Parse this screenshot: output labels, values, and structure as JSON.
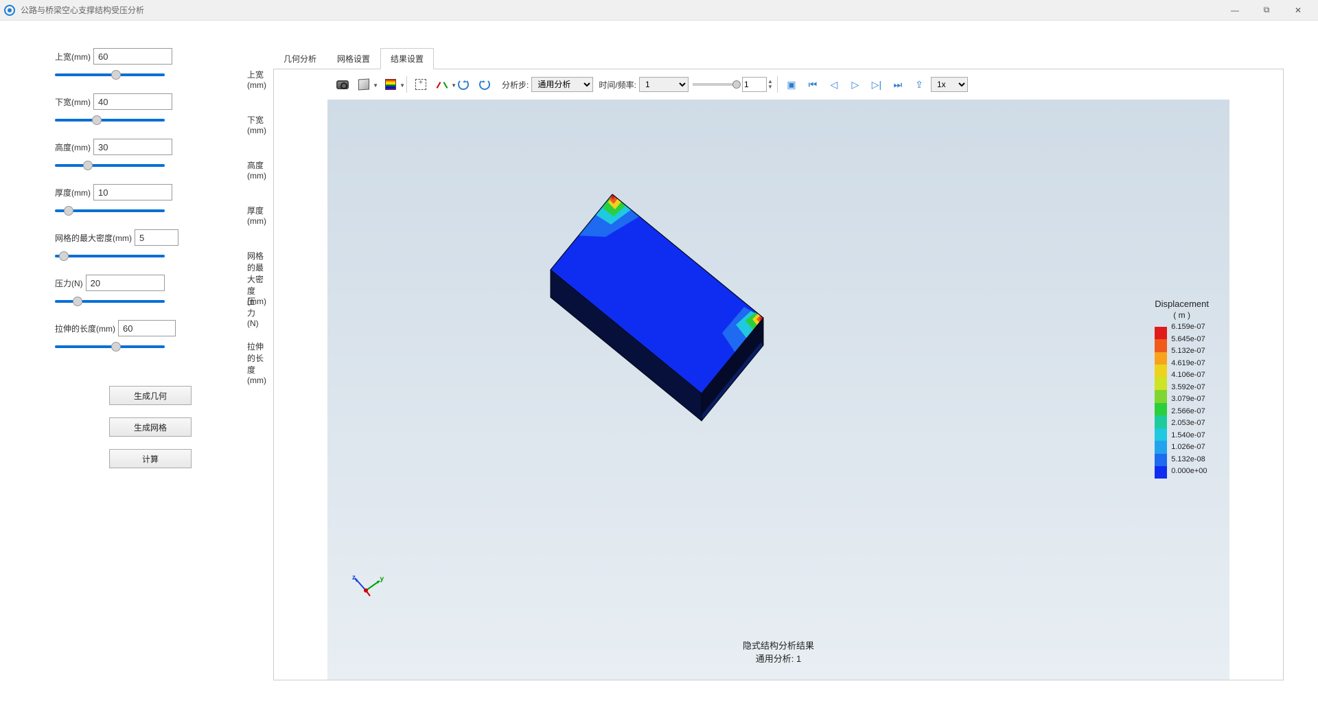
{
  "window": {
    "title": "公路与桥梁空心支撑结构受压分析",
    "controls": {
      "min": "—",
      "max": "⧉",
      "close": "✕"
    }
  },
  "panel": {
    "top_width": {
      "label": "上宽(mm)",
      "value": "60",
      "display": "上宽(mm)",
      "slider_pct": 56
    },
    "bottom_width": {
      "label": "下宽(mm)",
      "value": "40",
      "display": "下宽(mm)",
      "slider_pct": 37
    },
    "height": {
      "label": "高度(mm)",
      "value": "30",
      "display": "高度(mm)",
      "slider_pct": 28
    },
    "thickness": {
      "label": "厚度(mm)",
      "value": "10",
      "display": "厚度(mm)",
      "slider_pct": 9
    },
    "mesh_density": {
      "label": "网格的最大密度(mm)",
      "value": "5",
      "display": "网格的最大密度(mm)",
      "slider_pct": 4
    },
    "pressure": {
      "label": "压力(N)",
      "value": "20",
      "display": "压力(N)",
      "slider_pct": 18
    },
    "stretch_len": {
      "label": "拉伸的长度(mm)",
      "value": "60",
      "display": "拉伸的长度(mm)",
      "slider_pct": 56
    }
  },
  "actions": {
    "gen_geom": "生成几何",
    "gen_mesh": "生成网格",
    "compute": "计算"
  },
  "tabs": {
    "geom": "几何分析",
    "mesh": "网格设置",
    "result": "结果设置"
  },
  "toolbar": {
    "step_label": "分析步:",
    "step_value": "通用分析",
    "time_label": "时间/频率:",
    "time_value": "1",
    "step_spin": "1",
    "speed": "1x"
  },
  "caption": {
    "line1": "隐式结构分析结果",
    "line2": "通用分析: 1"
  },
  "legend": {
    "title": "Displacement",
    "unit": "( m )",
    "values": [
      "6.159e-07",
      "5.645e-07",
      "5.132e-07",
      "4.619e-07",
      "4.106e-07",
      "3.592e-07",
      "3.079e-07",
      "2.566e-07",
      "2.053e-07",
      "1.540e-07",
      "1.026e-07",
      "5.132e-08",
      "0.000e+00"
    ],
    "colors": [
      "#e01b1b",
      "#f05a1a",
      "#f7a41c",
      "#eed31e",
      "#cde427",
      "#7fd630",
      "#2bcf3c",
      "#1ecb9d",
      "#20c8e0",
      "#23a2ee",
      "#1e6af0",
      "#0f2df0"
    ]
  }
}
